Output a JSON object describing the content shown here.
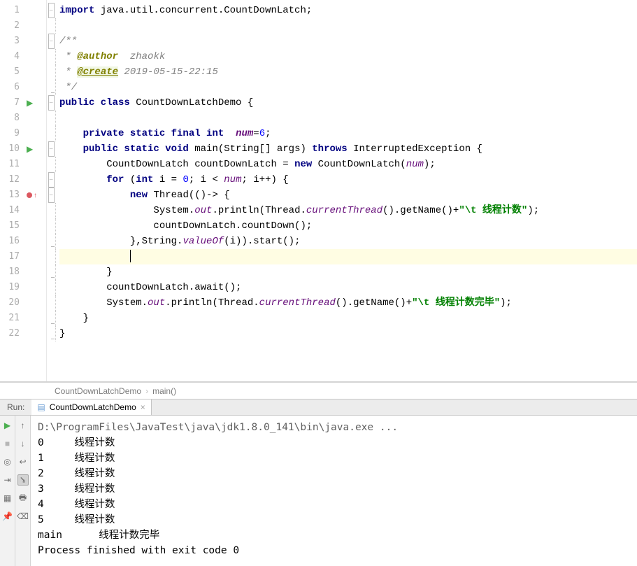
{
  "editor": {
    "lines": [
      {
        "n": 1,
        "fold": "box",
        "segs": [
          {
            "t": "import ",
            "c": "kw"
          },
          {
            "t": "java.util.concurrent.CountDownLatch;",
            "c": ""
          }
        ]
      },
      {
        "n": 2,
        "segs": []
      },
      {
        "n": 3,
        "fold": "box",
        "segs": [
          {
            "t": "/**",
            "c": "cmt"
          }
        ]
      },
      {
        "n": 4,
        "segs": [
          {
            "t": " * ",
            "c": "cmt"
          },
          {
            "t": "@author",
            "c": "ann"
          },
          {
            "t": "  zhaokk",
            "c": "cmt"
          }
        ]
      },
      {
        "n": 5,
        "segs": [
          {
            "t": " * ",
            "c": "cmt"
          },
          {
            "t": "@create",
            "c": "annU"
          },
          {
            "t": " 2019-05-15-22:15",
            "c": "cmt"
          }
        ]
      },
      {
        "n": 6,
        "fold": "end",
        "segs": [
          {
            "t": " */",
            "c": "cmt"
          }
        ]
      },
      {
        "n": 7,
        "marker": "play",
        "fold": "box",
        "segs": [
          {
            "t": "public class ",
            "c": "kw"
          },
          {
            "t": "CountDownLatchDemo {",
            "c": ""
          }
        ]
      },
      {
        "n": 8,
        "segs": []
      },
      {
        "n": 9,
        "segs": [
          {
            "t": "    ",
            "c": ""
          },
          {
            "t": "private static final int",
            "c": "kw"
          },
          {
            "t": "  ",
            "c": ""
          },
          {
            "t": "num",
            "c": "fld"
          },
          {
            "t": "=",
            "c": ""
          },
          {
            "t": "6",
            "c": "num"
          },
          {
            "t": ";",
            "c": ""
          }
        ]
      },
      {
        "n": 10,
        "marker": "play",
        "fold": "box",
        "segs": [
          {
            "t": "    ",
            "c": ""
          },
          {
            "t": "public static void ",
            "c": "kw"
          },
          {
            "t": "main(String[] args) ",
            "c": ""
          },
          {
            "t": "throws ",
            "c": "kw"
          },
          {
            "t": "InterruptedException {",
            "c": ""
          }
        ]
      },
      {
        "n": 11,
        "segs": [
          {
            "t": "        CountDownLatch countDownLatch = ",
            "c": ""
          },
          {
            "t": "new ",
            "c": "kw"
          },
          {
            "t": "CountDownLatch(",
            "c": ""
          },
          {
            "t": "num",
            "c": "fldS"
          },
          {
            "t": ");",
            "c": ""
          }
        ]
      },
      {
        "n": 12,
        "fold": "box",
        "segs": [
          {
            "t": "        ",
            "c": ""
          },
          {
            "t": "for ",
            "c": "kw"
          },
          {
            "t": "(",
            "c": ""
          },
          {
            "t": "int ",
            "c": "kw"
          },
          {
            "t": "i = ",
            "c": ""
          },
          {
            "t": "0",
            "c": "num"
          },
          {
            "t": "; i < ",
            "c": ""
          },
          {
            "t": "num",
            "c": "fldS"
          },
          {
            "t": "; i++) {",
            "c": ""
          }
        ]
      },
      {
        "n": 13,
        "marker": "red",
        "fold": "box",
        "segs": [
          {
            "t": "            ",
            "c": ""
          },
          {
            "t": "new ",
            "c": "kw"
          },
          {
            "t": "Thread(()-> {",
            "c": ""
          }
        ]
      },
      {
        "n": 14,
        "segs": [
          {
            "t": "                System.",
            "c": ""
          },
          {
            "t": "out",
            "c": "fldS"
          },
          {
            "t": ".println(Thread.",
            "c": ""
          },
          {
            "t": "currentThread",
            "c": "fldS"
          },
          {
            "t": "().getName()+",
            "c": ""
          },
          {
            "t": "\"\\t 线程计数\"",
            "c": "str"
          },
          {
            "t": ");",
            "c": ""
          }
        ]
      },
      {
        "n": 15,
        "segs": [
          {
            "t": "                countDownLatch.countDown();",
            "c": ""
          }
        ]
      },
      {
        "n": 16,
        "fold": "end",
        "segs": [
          {
            "t": "            },String.",
            "c": ""
          },
          {
            "t": "valueOf",
            "c": "fldS"
          },
          {
            "t": "(i)).start();",
            "c": ""
          }
        ]
      },
      {
        "n": 17,
        "hl": true,
        "caret": true,
        "segs": [
          {
            "t": "            ",
            "c": ""
          }
        ]
      },
      {
        "n": 18,
        "fold": "end",
        "segs": [
          {
            "t": "        }",
            "c": ""
          }
        ]
      },
      {
        "n": 19,
        "segs": [
          {
            "t": "        countDownLatch.await();",
            "c": ""
          }
        ]
      },
      {
        "n": 20,
        "segs": [
          {
            "t": "        System.",
            "c": ""
          },
          {
            "t": "out",
            "c": "fldS"
          },
          {
            "t": ".println(Thread.",
            "c": ""
          },
          {
            "t": "currentThread",
            "c": "fldS"
          },
          {
            "t": "().getName()+",
            "c": ""
          },
          {
            "t": "\"\\t 线程计数完毕\"",
            "c": "str"
          },
          {
            "t": ");",
            "c": ""
          }
        ]
      },
      {
        "n": 21,
        "fold": "end",
        "segs": [
          {
            "t": "    }",
            "c": ""
          }
        ]
      },
      {
        "n": 22,
        "fold": "end",
        "segs": [
          {
            "t": "}",
            "c": ""
          }
        ]
      }
    ]
  },
  "breadcrumb": {
    "class": "CountDownLatchDemo",
    "method": "main()"
  },
  "run": {
    "label": "Run:",
    "tab": "CountDownLatchDemo",
    "outputLines": [
      "D:\\ProgramFiles\\JavaTest\\java\\jdk1.8.0_141\\bin\\java.exe ...",
      "0     线程计数",
      "1     线程计数",
      "2     线程计数",
      "3     线程计数",
      "4     线程计数",
      "5     线程计数",
      "main      线程计数完毕",
      "",
      "Process finished with exit code 0"
    ]
  }
}
